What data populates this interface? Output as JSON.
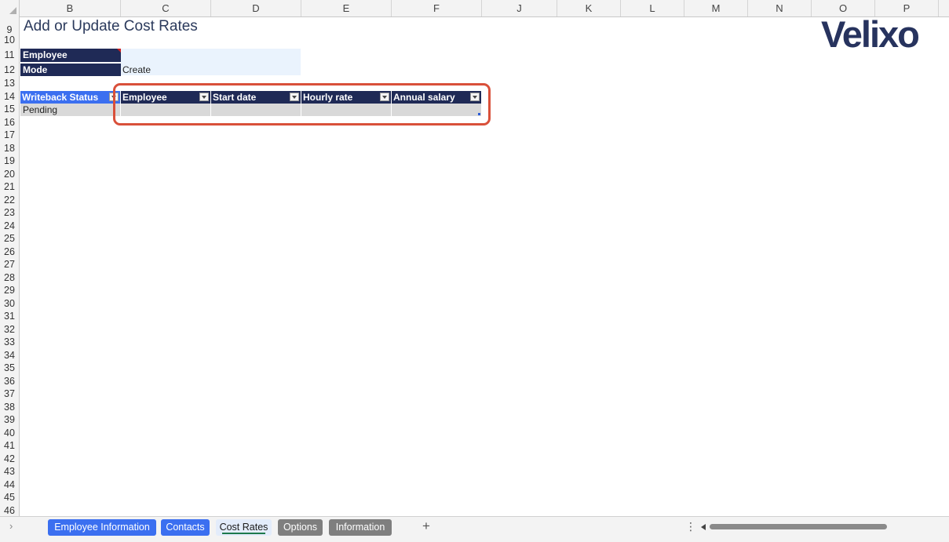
{
  "columns": [
    "B",
    "C",
    "D",
    "E",
    "F",
    "J",
    "K",
    "L",
    "M",
    "N",
    "O",
    "P"
  ],
  "rows": [
    "9",
    "10",
    "11",
    "12",
    "13",
    "14",
    "15",
    "16",
    "17",
    "18",
    "19",
    "20",
    "21",
    "22",
    "23",
    "24",
    "25",
    "26",
    "27",
    "28",
    "29",
    "30",
    "31",
    "32",
    "33",
    "34",
    "35",
    "36",
    "37",
    "38",
    "39",
    "40",
    "41",
    "42",
    "43",
    "44",
    "45",
    "46"
  ],
  "sheet": {
    "title": "Add or Update Cost Rates",
    "logo": "Velixo",
    "form": {
      "employee_label": "Employee",
      "employee_value": "",
      "mode_label": "Mode",
      "mode_value": "Create"
    },
    "table": {
      "headers": [
        "Writeback Status",
        "Employee",
        "Start date",
        "Hourly rate",
        "Annual salary"
      ],
      "row": [
        "Pending",
        "",
        "",
        "",
        ""
      ]
    }
  },
  "tabs": [
    {
      "label": "Employee Information",
      "style": "blue"
    },
    {
      "label": "Contacts",
      "style": "blue"
    },
    {
      "label": "Cost Rates",
      "style": "active"
    },
    {
      "label": "Options",
      "style": "gray"
    },
    {
      "label": "Information",
      "style": "gray"
    }
  ],
  "tabbar": {
    "nav_arrow": "›",
    "add_sheet": "+",
    "more_menu": "⋮"
  },
  "colors": {
    "navy": "#1f2a56",
    "blue_header": "#3b6ff0",
    "input_bg": "#eaf3fd",
    "highlight": "#d9503a"
  }
}
